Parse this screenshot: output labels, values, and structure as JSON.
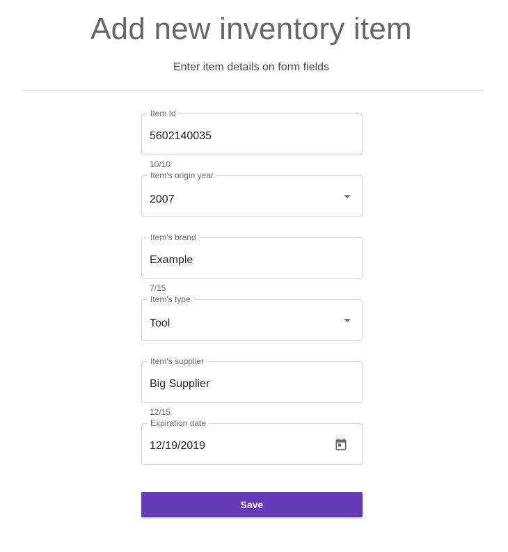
{
  "header": {
    "title": "Add new inventory item",
    "subtitle": "Enter item details on form fields"
  },
  "form": {
    "item_id": {
      "label": "Item Id",
      "value": "5602140035",
      "counter": "10/10"
    },
    "origin_year": {
      "label": "Item's origin year",
      "value": "2007",
      "icon": "dropdown-arrow-icon"
    },
    "brand": {
      "label": "Item's brand",
      "value": "Example",
      "counter": "7/15"
    },
    "type": {
      "label": "Item's type",
      "value": "Tool",
      "icon": "dropdown-arrow-icon"
    },
    "supplier": {
      "label": "Item's supplier",
      "value": "Big Supplier",
      "counter": "12/15"
    },
    "expiration_date": {
      "label": "Expiration date",
      "value": "12/19/2019",
      "icon": "calendar-icon"
    },
    "save_label": "Save"
  },
  "colors": {
    "accent": "#673ab7",
    "border": "#d3d3d3",
    "divider": "#dcdcdc"
  }
}
